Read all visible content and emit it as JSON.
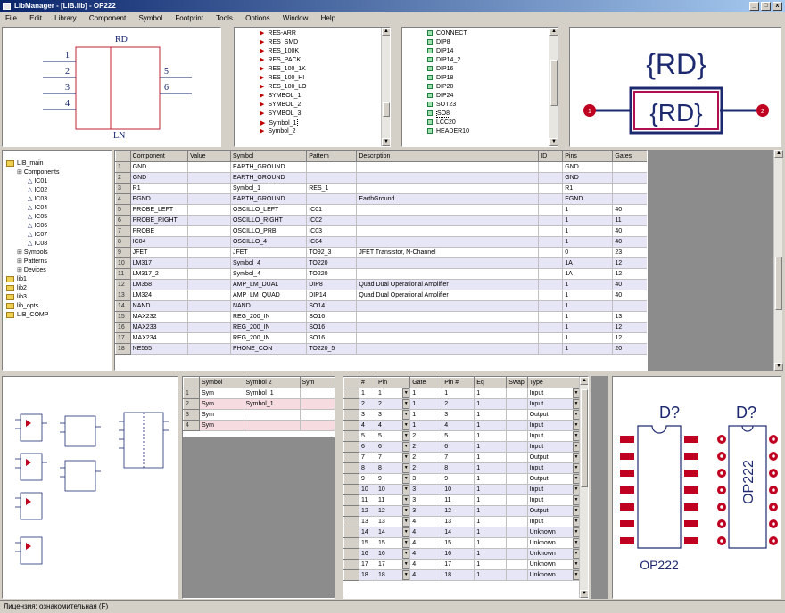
{
  "window": {
    "title": "LibManager - [LIB.lib] - OP222",
    "minimize": "_",
    "maximize": "□",
    "close": "x"
  },
  "menu": [
    "File",
    "Edit",
    "Library",
    "Component",
    "Symbol",
    "Footprint",
    "Tools",
    "Options",
    "Window",
    "Help"
  ],
  "symbol_preview": {
    "ref": "RD",
    "value": "LN",
    "pins_left": [
      "1",
      "2",
      "3",
      "4"
    ],
    "pins_right": [
      "5",
      "6"
    ]
  },
  "symbols_list": [
    "RES-ARR",
    "RES_SMD",
    "RES_100K",
    "RES_PACK",
    "RES_100_1K",
    "RES_100_HI",
    "RES_100_LO",
    "SYMBOL_1",
    "SYMBOL_2",
    "SYMBOL_3",
    "Symbol_1",
    "Symbol_2"
  ],
  "symbols_selected": 10,
  "footprints_list": [
    "CONNECT",
    "DIP8",
    "DIP14",
    "DIP14_2",
    "DIP16",
    "DIP18",
    "DIP20",
    "DIP24",
    "SOT23",
    "SO8",
    "LCC20",
    "HEADER10"
  ],
  "footprints_selected": 9,
  "rd_preview": {
    "top_label": "{RD}",
    "body_label": "{RD}",
    "pin_left": "1",
    "pin_right": "2"
  },
  "tree": [
    {
      "label": "LIB_main",
      "level": 0,
      "type": "folder"
    },
    {
      "label": "Components",
      "level": 1,
      "type": "group"
    },
    {
      "label": "IC01",
      "level": 2,
      "type": "item"
    },
    {
      "label": "IC02",
      "level": 2,
      "type": "item"
    },
    {
      "label": "IC03",
      "level": 2,
      "type": "item"
    },
    {
      "label": "IC04",
      "level": 2,
      "type": "item"
    },
    {
      "label": "IC05",
      "level": 2,
      "type": "item"
    },
    {
      "label": "IC06",
      "level": 2,
      "type": "item"
    },
    {
      "label": "IC07",
      "level": 2,
      "type": "item"
    },
    {
      "label": "IC08",
      "level": 2,
      "type": "item"
    },
    {
      "label": "Symbols",
      "level": 1,
      "type": "group"
    },
    {
      "label": "Patterns",
      "level": 1,
      "type": "group"
    },
    {
      "label": "Devices",
      "level": 1,
      "type": "group"
    },
    {
      "label": "lib1",
      "level": 0,
      "type": "folder"
    },
    {
      "label": "lib2",
      "level": 0,
      "type": "folder"
    },
    {
      "label": "lib3",
      "level": 0,
      "type": "folder"
    },
    {
      "label": "lib_opts",
      "level": 0,
      "type": "folder"
    },
    {
      "label": "LIB_COMP",
      "level": 0,
      "type": "folder"
    }
  ],
  "comp_table": {
    "columns": [
      "Component",
      "Value",
      "Symbol",
      "Pattern",
      "Description",
      "ID",
      "Pins",
      "Gates"
    ],
    "rows": [
      [
        "GND",
        "",
        "EARTH_GROUND",
        "",
        "",
        "",
        "GND",
        ""
      ],
      [
        "GND",
        "",
        "EARTH_GROUND",
        "",
        "",
        "",
        "GND",
        ""
      ],
      [
        "R1",
        "",
        "Symbol_1",
        "RES_1",
        "",
        "",
        "R1",
        ""
      ],
      [
        "EGND",
        "",
        "EARTH_GROUND",
        "",
        "EarthGround",
        "",
        "EGND",
        ""
      ],
      [
        "PROBE_LEFT",
        "",
        "OSCILLO_LEFT",
        "IC01",
        "",
        "",
        "1",
        "40"
      ],
      [
        "PROBE_RIGHT",
        "",
        "OSCILLO_RIGHT",
        "IC02",
        "",
        "",
        "1",
        "11"
      ],
      [
        "PROBE",
        "",
        "OSCILLO_PRB",
        "IC03",
        "",
        "",
        "1",
        "40"
      ],
      [
        "IC04",
        "",
        "OSCILLO_4",
        "IC04",
        "",
        "",
        "1",
        "40"
      ],
      [
        "JFET",
        "",
        "JFET",
        "TO92_3",
        "JFET Transistor, N-Channel",
        "",
        "0",
        "23"
      ],
      [
        "LM317",
        "",
        "Symbol_4",
        "TO220",
        "",
        "",
        "1A",
        "12"
      ],
      [
        "LM317_2",
        "",
        "Symbol_4",
        "TO220",
        "",
        "",
        "1A",
        "12"
      ],
      [
        "LM358",
        "",
        "AMP_LM_DUAL",
        "DIP8",
        "Quad Dual Operational Amplifier",
        "",
        "1",
        "40"
      ],
      [
        "LM324",
        "",
        "AMP_LM_QUAD",
        "DIP14",
        "Quad Dual Operational Amplifier",
        "",
        "1",
        "40"
      ],
      [
        "NAND",
        "",
        "NAND",
        "SO14",
        "",
        "",
        "1",
        ""
      ],
      [
        "MAX232",
        "",
        "REG_200_IN",
        "SO16",
        "",
        "",
        "1",
        "13"
      ],
      [
        "MAX233",
        "",
        "REG_200_IN",
        "SO16",
        "",
        "",
        "1",
        "12"
      ],
      [
        "MAX234",
        "",
        "REG_200_IN",
        "SO16",
        "",
        "",
        "1",
        "12"
      ],
      [
        "NE555",
        "",
        "PHONE_CON",
        "TO220_5",
        "",
        "",
        "1",
        "20"
      ]
    ]
  },
  "gates_table": {
    "columns": [
      "Symbol",
      "Symbol 2",
      "Sym"
    ],
    "rows": [
      [
        "Sym",
        "Symbol_1",
        ""
      ],
      [
        "Sym",
        "Symbol_1",
        ""
      ],
      [
        "Sym",
        "",
        ""
      ],
      [
        "Sym",
        "",
        ""
      ]
    ]
  },
  "pins_table": {
    "columns": [
      "#",
      "Pin",
      "Gate",
      "Pin #",
      "Eq",
      "Swap",
      "Type"
    ],
    "rows": [
      [
        "1",
        "1",
        "1",
        "1",
        "1",
        "",
        "Input"
      ],
      [
        "2",
        "2",
        "1",
        "2",
        "1",
        "",
        "Input"
      ],
      [
        "3",
        "3",
        "1",
        "3",
        "1",
        "",
        "Output"
      ],
      [
        "4",
        "4",
        "1",
        "4",
        "1",
        "",
        "Input"
      ],
      [
        "5",
        "5",
        "2",
        "5",
        "1",
        "",
        "Input"
      ],
      [
        "6",
        "6",
        "2",
        "6",
        "1",
        "",
        "Input"
      ],
      [
        "7",
        "7",
        "2",
        "7",
        "1",
        "",
        "Output"
      ],
      [
        "8",
        "8",
        "2",
        "8",
        "1",
        "",
        "Input"
      ],
      [
        "9",
        "9",
        "3",
        "9",
        "1",
        "",
        "Output"
      ],
      [
        "10",
        "10",
        "3",
        "10",
        "1",
        "",
        "Input"
      ],
      [
        "11",
        "11",
        "3",
        "11",
        "1",
        "",
        "Input"
      ],
      [
        "12",
        "12",
        "3",
        "12",
        "1",
        "",
        "Output"
      ],
      [
        "13",
        "13",
        "4",
        "13",
        "1",
        "",
        "Input"
      ],
      [
        "14",
        "14",
        "4",
        "14",
        "1",
        "",
        "Unknown"
      ],
      [
        "15",
        "15",
        "4",
        "15",
        "1",
        "",
        "Unknown"
      ],
      [
        "16",
        "16",
        "4",
        "16",
        "1",
        "",
        "Unknown"
      ],
      [
        "17",
        "17",
        "4",
        "17",
        "1",
        "",
        "Unknown"
      ],
      [
        "18",
        "18",
        "4",
        "18",
        "1",
        "",
        "Unknown"
      ]
    ]
  },
  "footprint_preview": {
    "refdes1": "D?",
    "refdes2": "D?",
    "part1": "OP222",
    "part2": "OP222"
  },
  "status": "Лицензия: ознакомительная (F)"
}
